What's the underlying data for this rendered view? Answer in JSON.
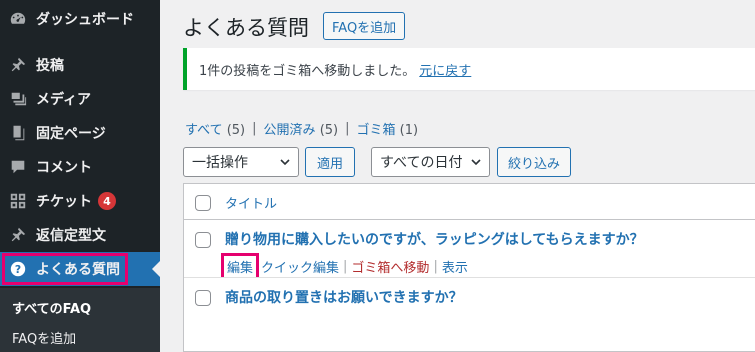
{
  "sidebar": {
    "items": [
      {
        "label": "ダッシュボード",
        "icon": "dashboard-icon"
      },
      {
        "label": "投稿",
        "icon": "pin-icon"
      },
      {
        "label": "メディア",
        "icon": "media-icon"
      },
      {
        "label": "固定ページ",
        "icon": "pages-icon"
      },
      {
        "label": "コメント",
        "icon": "comment-icon"
      },
      {
        "label": "チケット",
        "icon": "grid-icon",
        "badge": "4"
      },
      {
        "label": "返信定型文",
        "icon": "pin-icon"
      },
      {
        "label": "よくある質問",
        "icon": "help-icon"
      }
    ],
    "submenu": [
      {
        "label": "すべてのFAQ"
      },
      {
        "label": "FAQを追加"
      }
    ]
  },
  "header": {
    "title": "よくある質問",
    "add_button": "FAQを追加"
  },
  "notice": {
    "message": "1件の投稿をゴミ箱へ移動しました。",
    "undo_link": "元に戻す"
  },
  "filters": {
    "all_label": "すべて",
    "all_count": "(5)",
    "published_label": "公開済み",
    "published_count": "(5)",
    "trash_label": "ゴミ箱",
    "trash_count": "(1)",
    "separator": "|"
  },
  "toolbar": {
    "bulk_action": "一括操作",
    "apply": "適用",
    "date_filter": "すべての日付",
    "filter_button": "絞り込み"
  },
  "table": {
    "column_title": "タイトル",
    "rows": [
      {
        "title": "贈り物用に購入したいのですが、ラッピングはしてもらえますか？",
        "actions": {
          "edit": "編集",
          "quick_edit": "クイック編集",
          "trash": "ゴミ箱へ移動",
          "view": "表示"
        }
      },
      {
        "title": "商品の取り置きはお願いできますか？"
      }
    ]
  },
  "colors": {
    "sidebar_bg": "#1d2327",
    "accent": "#2271b1",
    "highlight": "#e5006e",
    "success": "#00a32a",
    "danger": "#b32d2e"
  }
}
